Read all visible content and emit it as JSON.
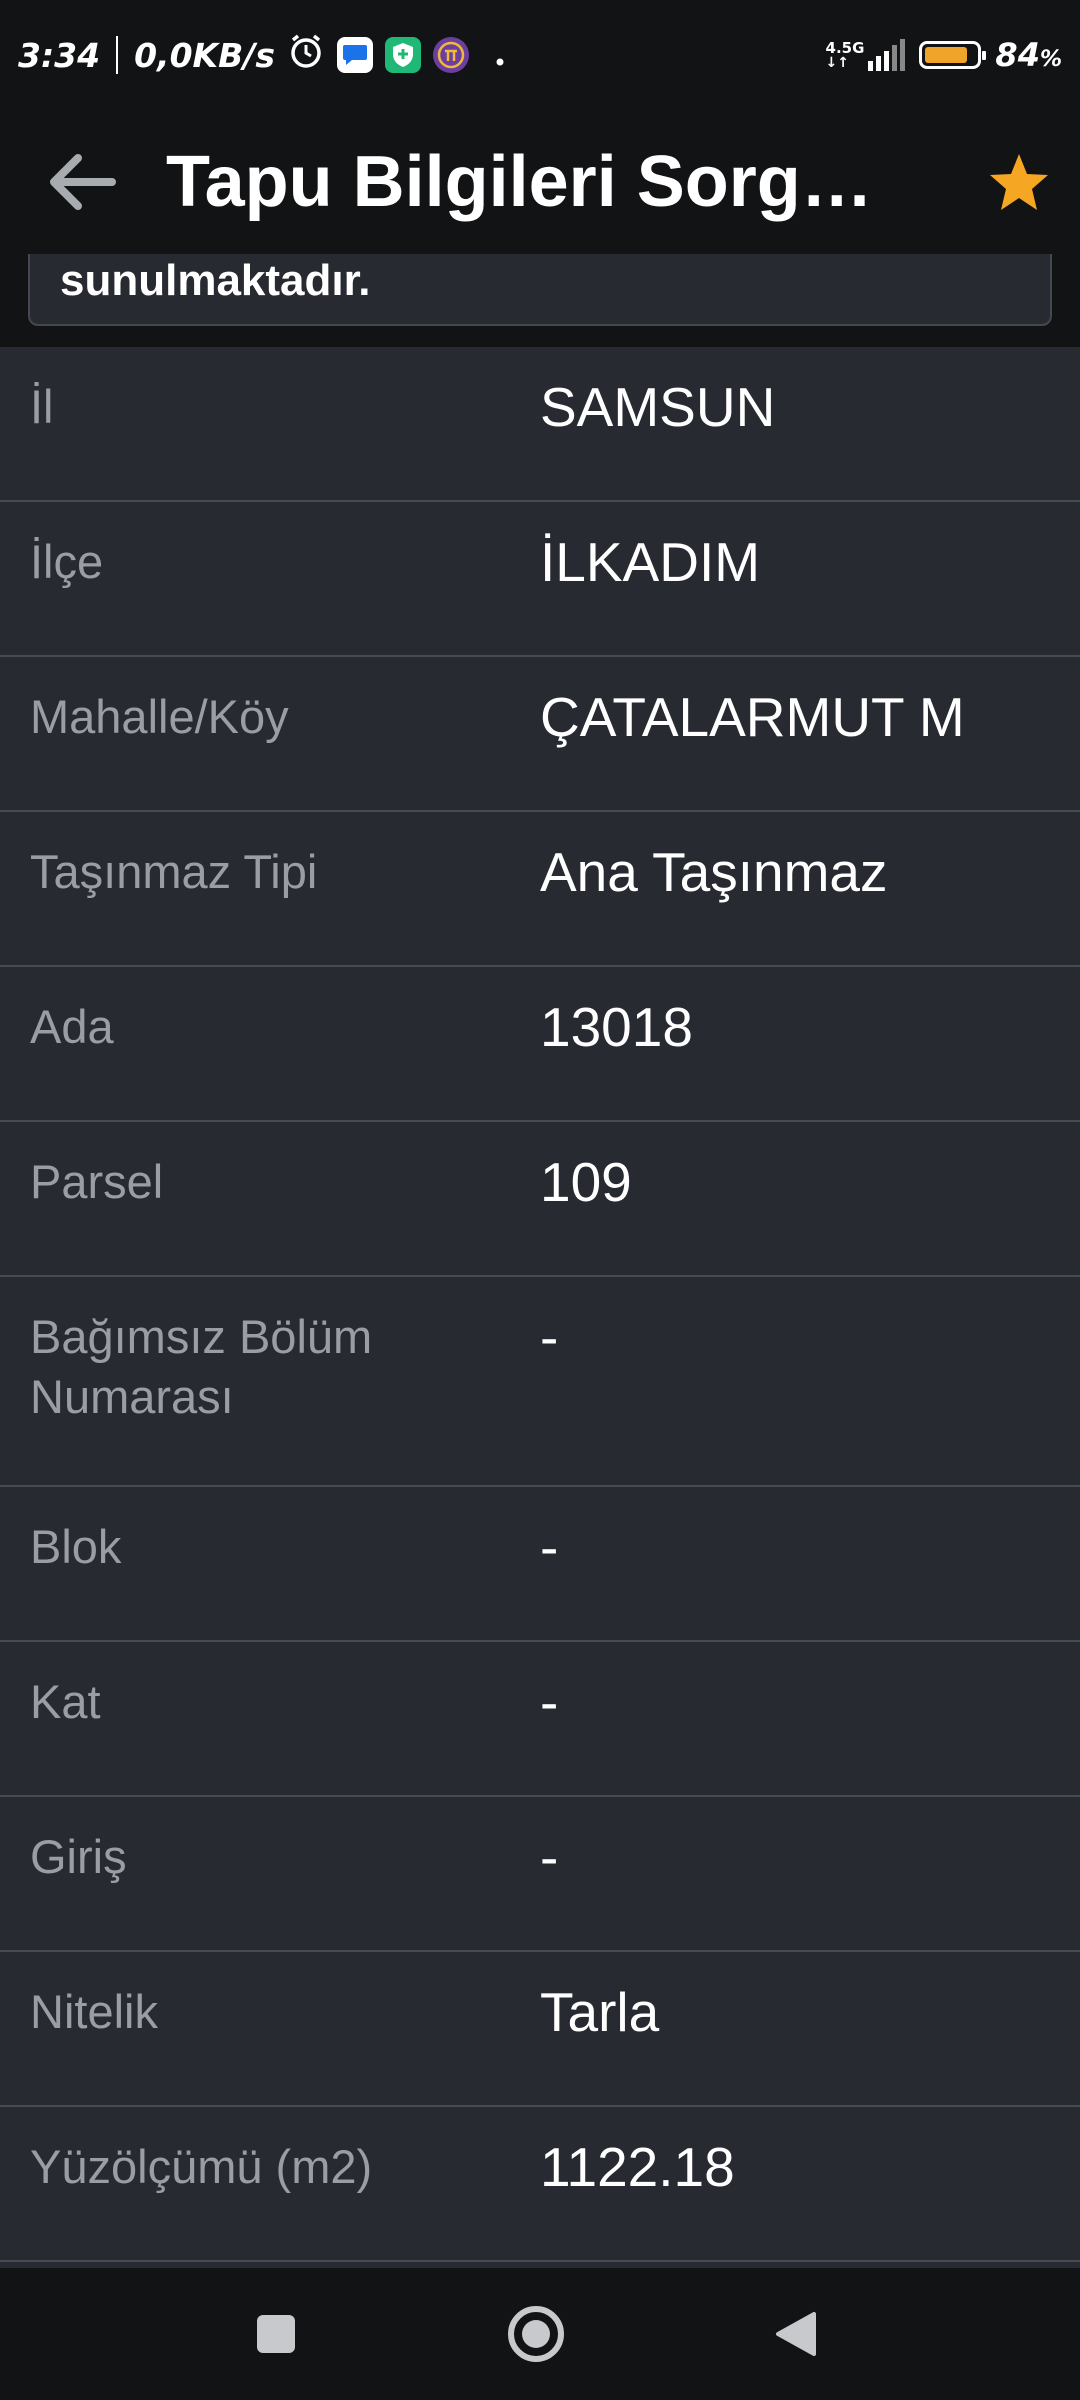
{
  "status_bar": {
    "time": "3:34",
    "net_speed": "0,0KB/s",
    "network_type": "4.5G",
    "battery_percent": "84",
    "battery_suffix": "%",
    "battery_level": 0.84,
    "icons": [
      "alarm-icon",
      "messages-icon",
      "shield-icon",
      "pi-icon",
      "dot-icon"
    ]
  },
  "app_bar": {
    "title": "Tapu Bilgileri Sorg…",
    "accent_color": "#f5a623"
  },
  "notice": {
    "text": "sunulmaktadır."
  },
  "rows": [
    {
      "label": "İl",
      "value": "SAMSUN"
    },
    {
      "label": "İlçe",
      "value": "İLKADIM"
    },
    {
      "label": "Mahalle/Köy",
      "value": "ÇATALARMUT M"
    },
    {
      "label": "Taşınmaz Tipi",
      "value": "Ana Taşınmaz"
    },
    {
      "label": "Ada",
      "value": "13018"
    },
    {
      "label": "Parsel",
      "value": "109"
    },
    {
      "label": "Bağımsız Bölüm Numarası",
      "value": "-"
    },
    {
      "label": "Blok",
      "value": "-"
    },
    {
      "label": "Kat",
      "value": "-"
    },
    {
      "label": "Giriş",
      "value": "-"
    },
    {
      "label": "Nitelik",
      "value": "Tarla"
    },
    {
      "label": "Yüzölçümü (m2)",
      "value": "1122.18"
    }
  ]
}
